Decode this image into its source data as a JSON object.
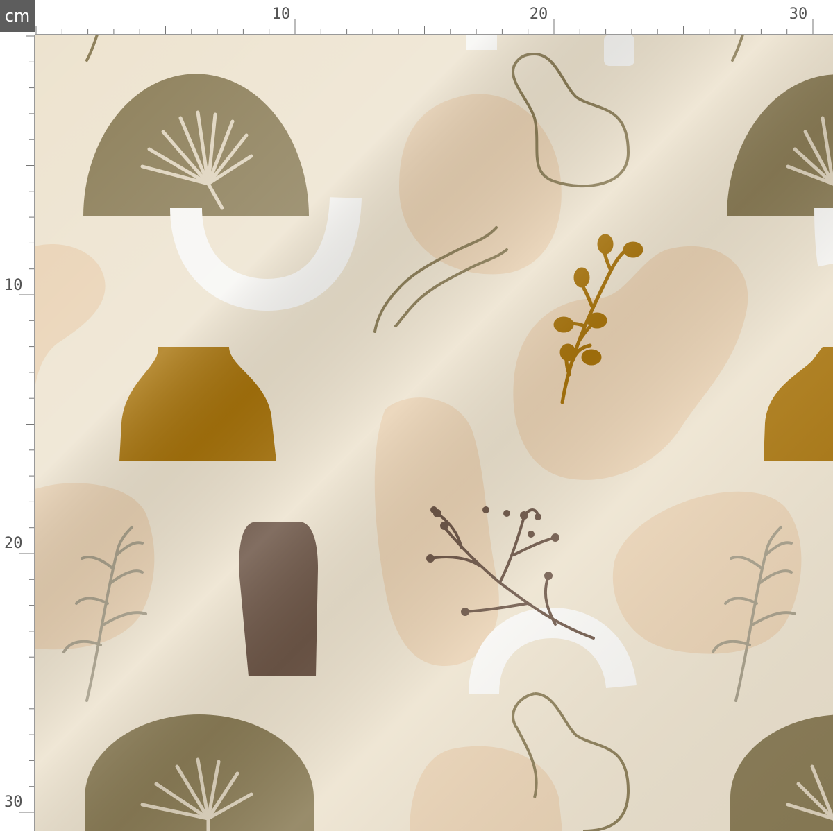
{
  "ruler": {
    "unit": "cm",
    "top_labels": [
      "10",
      "20",
      "30"
    ],
    "left_labels": [
      "10",
      "20",
      "30"
    ]
  },
  "colors": {
    "background": "#ede3cf",
    "olive": "#8b7d57",
    "mustard": "#a8740c",
    "brown": "#6e5748",
    "peach": "#e8cfb0",
    "white": "#f7f6f3",
    "sage": "#a79f8a",
    "ruler_bg": "#ffffff",
    "ruler_badge": "#5d5d5d"
  },
  "motifs": [
    {
      "name": "olive-half-dome",
      "icon": "half-circle"
    },
    {
      "name": "palm-leaf",
      "icon": "fan-leaf"
    },
    {
      "name": "white-arch",
      "icon": "arch"
    },
    {
      "name": "peach-blob",
      "icon": "organic-blob"
    },
    {
      "name": "line-loop",
      "icon": "squiggle-loop"
    },
    {
      "name": "wavy-lines",
      "icon": "waves"
    },
    {
      "name": "mustard-sprig",
      "icon": "flower-sprig"
    },
    {
      "name": "mustard-vase",
      "icon": "vase"
    },
    {
      "name": "brown-vase",
      "icon": "vase-tall"
    },
    {
      "name": "brown-coral-branch",
      "icon": "branch"
    },
    {
      "name": "sage-fern",
      "icon": "fern"
    }
  ]
}
